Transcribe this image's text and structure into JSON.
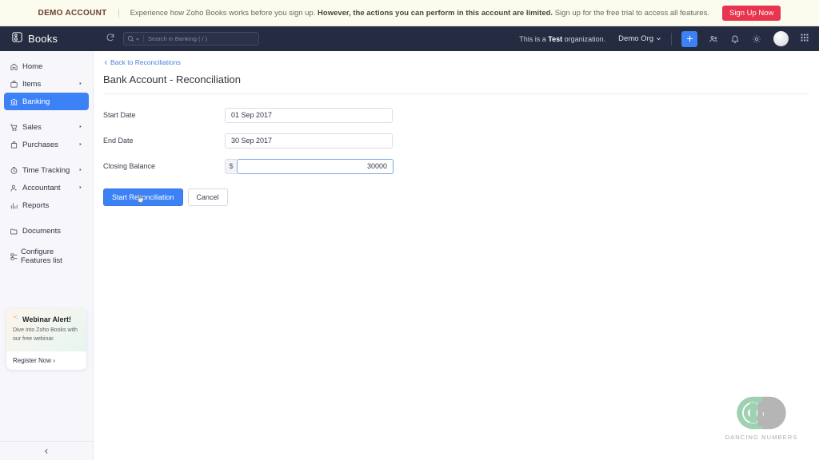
{
  "banner": {
    "label": "DEMO ACCOUNT",
    "text_1": "Experience how Zoho Books works before you sign up. ",
    "text_bold": "However, the actions you can perform in this account are limited.",
    "text_2": " Sign up for the free trial to access all features.",
    "signup_label": "Sign Up Now",
    "accent": "#e8344e",
    "background": "#fbfbee"
  },
  "topnav": {
    "brand": "Books",
    "search_placeholder": "Search in Banking ( / )",
    "test_org_prefix": "This is a ",
    "test_org_bold": "Test",
    "test_org_suffix": " organization.",
    "org_name": "Demo Org",
    "background": "#252b41",
    "accent": "#3c82f6"
  },
  "sidebar": {
    "background": "#f6f6fb",
    "active_color": "#3c82f6",
    "items": [
      {
        "label": "Home",
        "icon": "home-icon",
        "caret": false,
        "active": false,
        "gap_after": false
      },
      {
        "label": "Items",
        "icon": "box-icon",
        "caret": true,
        "active": false,
        "gap_after": false
      },
      {
        "label": "Banking",
        "icon": "bank-icon",
        "caret": false,
        "active": true,
        "gap_after": true
      },
      {
        "label": "Sales",
        "icon": "cart-icon",
        "caret": true,
        "active": false,
        "gap_after": false
      },
      {
        "label": "Purchases",
        "icon": "bag-icon",
        "caret": true,
        "active": false,
        "gap_after": true
      },
      {
        "label": "Time Tracking",
        "icon": "clock-icon",
        "caret": true,
        "active": false,
        "gap_after": false
      },
      {
        "label": "Accountant",
        "icon": "person-icon",
        "caret": true,
        "active": false,
        "gap_after": false
      },
      {
        "label": "Reports",
        "icon": "chart-icon",
        "caret": false,
        "active": false,
        "gap_after": true
      },
      {
        "label": "Documents",
        "icon": "folder-icon",
        "caret": false,
        "active": false,
        "gap_after": true
      },
      {
        "label": "Configure Features list",
        "icon": "config-icon",
        "caret": false,
        "active": false,
        "gap_after": false
      }
    ],
    "webinar": {
      "title": "Webinar Alert!",
      "subtitle": "Dive into Zoho Books with our free webinar.",
      "cta": "Register Now ›"
    }
  },
  "main": {
    "back_link": "Back to Reconciliations",
    "page_title": "Bank Account - Reconciliation",
    "form": {
      "fields": [
        {
          "label": "Start Date",
          "value": "01 Sep 2017",
          "type": "text",
          "name": "start-date"
        },
        {
          "label": "End Date",
          "value": "30 Sep 2017",
          "type": "text",
          "name": "end-date"
        }
      ],
      "closing_balance": {
        "label": "Closing Balance",
        "currency": "$",
        "value": "30000"
      },
      "primary_button": "Start Reconciliation",
      "secondary_button": "Cancel"
    }
  },
  "watermark": {
    "text": "DANCING NUMBERS",
    "green": "#8ec9a4",
    "gray": "#a8a8a8"
  }
}
